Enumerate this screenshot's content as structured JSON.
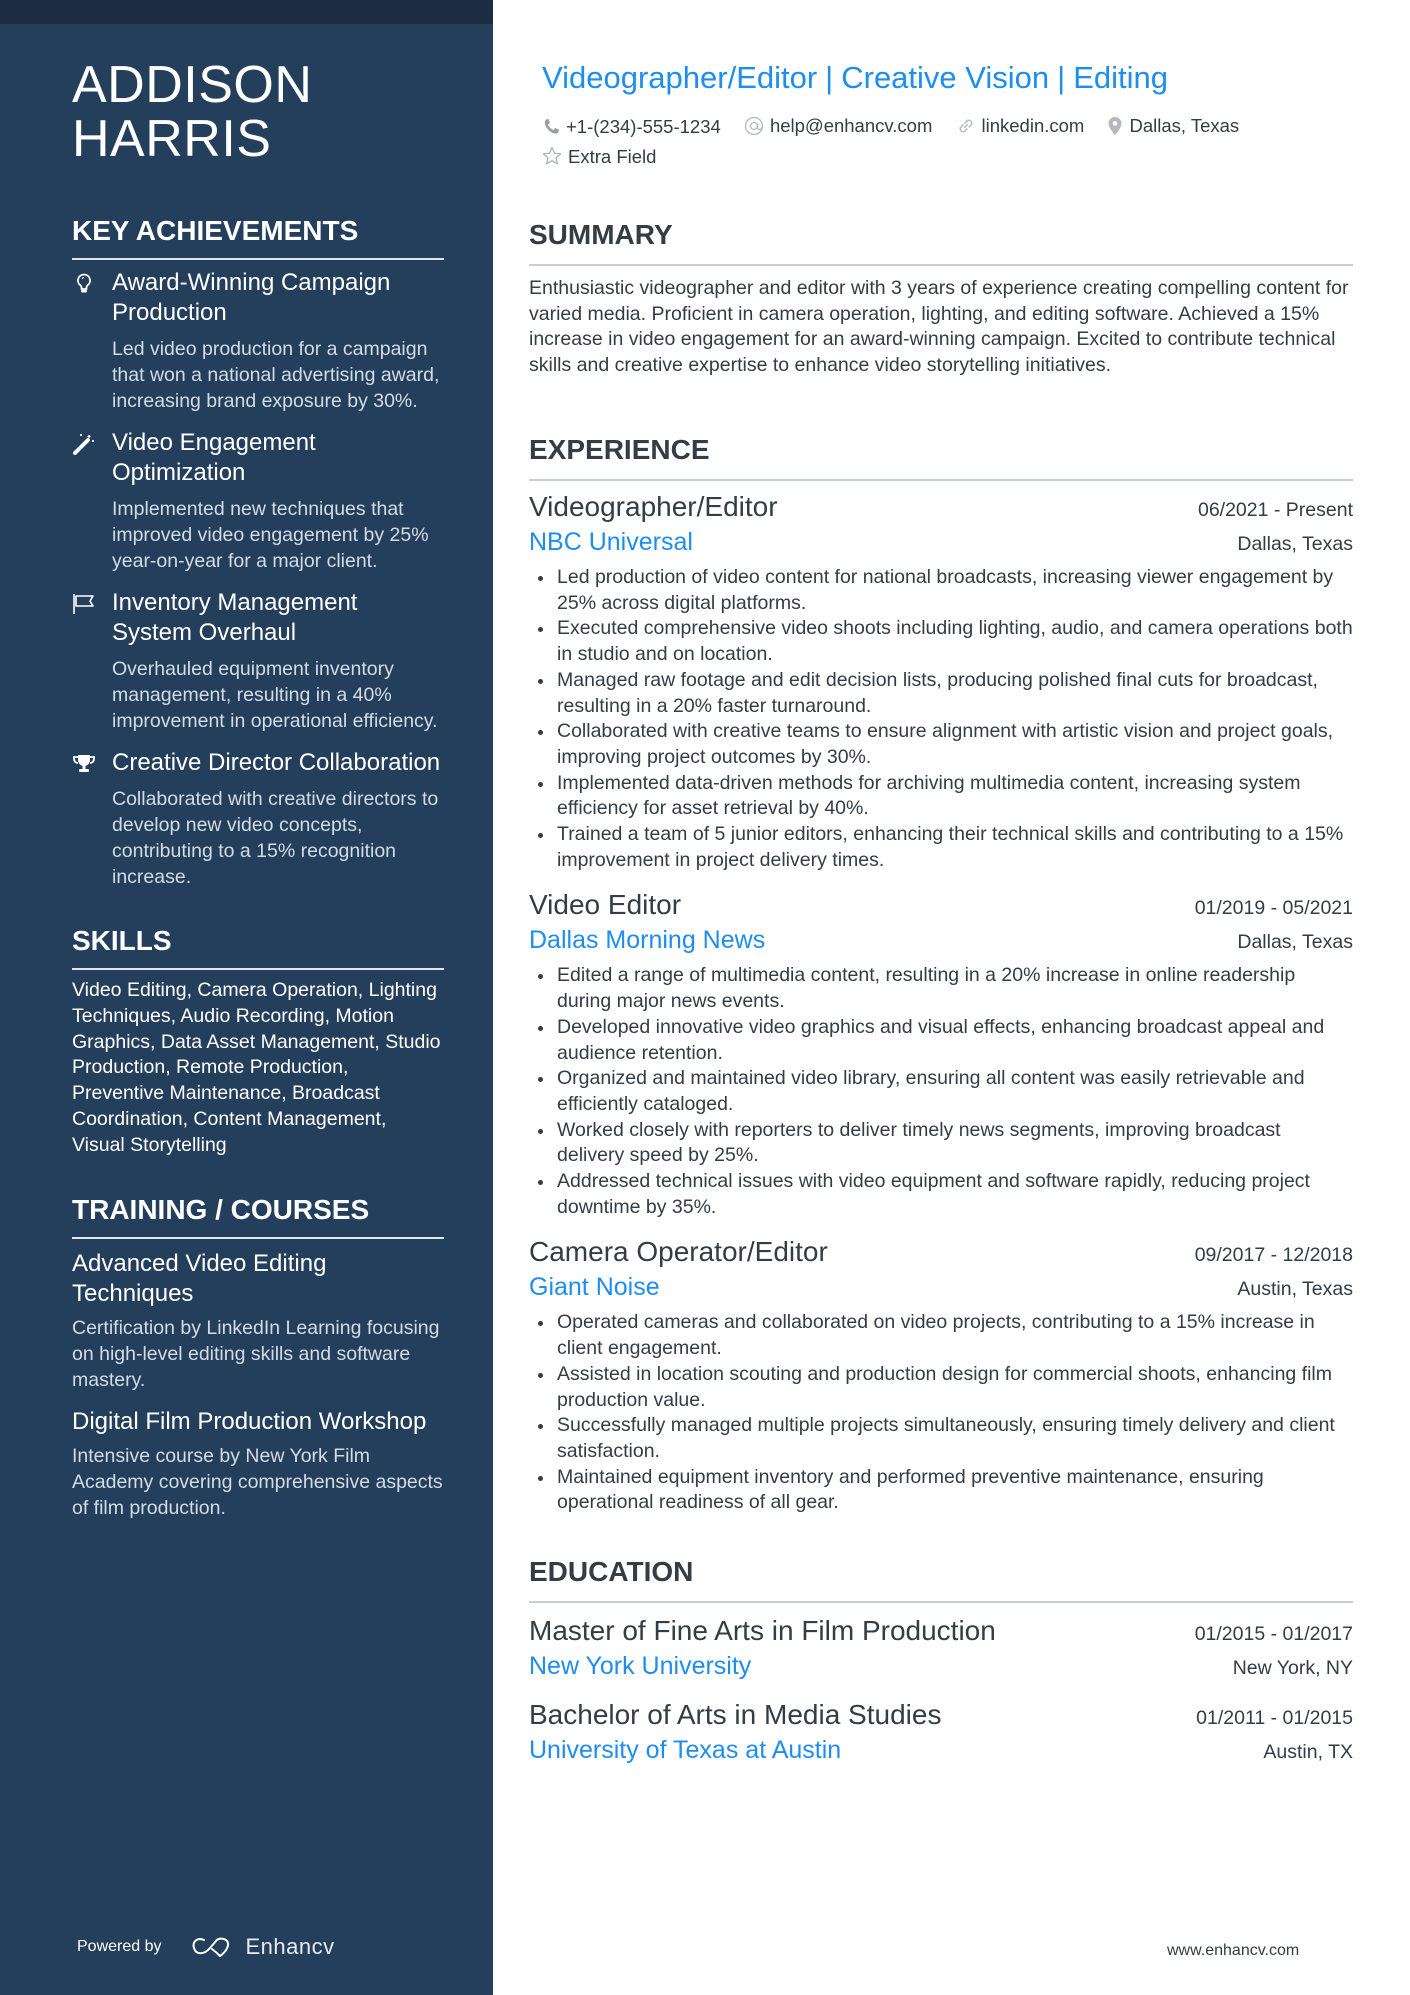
{
  "profile": {
    "name_line1": "ADDISON",
    "name_line2": "HARRIS",
    "headline": [
      "Videographer/Editor",
      "Creative Vision",
      "Editing"
    ],
    "headline_separator": "|",
    "contacts": {
      "phone": "+1-(234)-555-1234",
      "email": "help@enhancv.com",
      "link": "linkedin.com",
      "location": "Dallas, Texas",
      "extra": "Extra Field"
    }
  },
  "sidebar": {
    "achievements_heading": "KEY ACHIEVEMENTS",
    "achievements": [
      {
        "icon": "lightbulb-icon",
        "title": "Award-Winning Campaign Production",
        "desc": "Led video production for a campaign that won a national advertising award, increasing brand exposure by 30%."
      },
      {
        "icon": "magic-wand-icon",
        "title": "Video Engagement Optimization",
        "desc": "Implemented new techniques that improved video engagement by 25% year-on-year for a major client."
      },
      {
        "icon": "flag-icon",
        "title": "Inventory Management System Overhaul",
        "desc": "Overhauled equipment inventory management, resulting in a 40% improvement in operational efficiency."
      },
      {
        "icon": "trophy-icon",
        "title": "Creative Director Collaboration",
        "desc": "Collaborated with creative directors to develop new video concepts, contributing to a 15% recognition increase."
      }
    ],
    "skills_heading": "SKILLS",
    "skills_text": "Video Editing, Camera Operation, Lighting Techniques, Audio Recording, Motion Graphics, Data Asset Management, Studio Production, Remote Production, Preventive Maintenance, Broadcast Coordination, Content Management, Visual Storytelling",
    "training_heading": "TRAINING / COURSES",
    "courses": [
      {
        "title": "Advanced Video Editing Techniques",
        "desc": "Certification by LinkedIn Learning focusing on high-level editing skills and software mastery."
      },
      {
        "title": "Digital Film Production Workshop",
        "desc": "Intensive course by New York Film Academy covering comprehensive aspects of film production."
      }
    ],
    "powered_by": "Powered by",
    "brand": "Enhancv"
  },
  "summary": {
    "heading": "SUMMARY",
    "text": "Enthusiastic videographer and editor with 3 years of experience creating compelling content for varied media. Proficient in camera operation, lighting, and editing software. Achieved a 15% increase in video engagement for an award-winning campaign. Excited to contribute technical skills and creative expertise to enhance video storytelling initiatives."
  },
  "experience": {
    "heading": "EXPERIENCE",
    "jobs": [
      {
        "title": "Videographer/Editor",
        "dates": "06/2021 - Present",
        "company": "NBC Universal",
        "location": "Dallas, Texas",
        "bullets": [
          "Led production of video content for national broadcasts, increasing viewer engagement by 25% across digital platforms.",
          "Executed comprehensive video shoots including lighting, audio, and camera operations both in studio and on location.",
          "Managed raw footage and edit decision lists, producing polished final cuts for broadcast, resulting in a 20% faster turnaround.",
          "Collaborated with creative teams to ensure alignment with artistic vision and project goals, improving project outcomes by 30%.",
          "Implemented data-driven methods for archiving multimedia content, increasing system efficiency for asset retrieval by 40%.",
          "Trained a team of 5 junior editors, enhancing their technical skills and contributing to a 15% improvement in project delivery times."
        ]
      },
      {
        "title": "Video Editor",
        "dates": "01/2019 - 05/2021",
        "company": "Dallas Morning News",
        "location": "Dallas, Texas",
        "bullets": [
          "Edited a range of multimedia content, resulting in a 20% increase in online readership during major news events.",
          "Developed innovative video graphics and visual effects, enhancing broadcast appeal and audience retention.",
          "Organized and maintained video library, ensuring all content was easily retrievable and efficiently cataloged.",
          "Worked closely with reporters to deliver timely news segments, improving broadcast delivery speed by 25%.",
          "Addressed technical issues with video equipment and software rapidly, reducing project downtime by 35%."
        ]
      },
      {
        "title": "Camera Operator/Editor",
        "dates": "09/2017 - 12/2018",
        "company": "Giant Noise",
        "location": "Austin, Texas",
        "bullets": [
          "Operated cameras and collaborated on video projects, contributing to a 15% increase in client engagement.",
          "Assisted in location scouting and production design for commercial shoots, enhancing film production value.",
          "Successfully managed multiple projects simultaneously, ensuring timely delivery and client satisfaction.",
          "Maintained equipment inventory and performed preventive maintenance, ensuring operational readiness of all gear."
        ]
      }
    ]
  },
  "education": {
    "heading": "EDUCATION",
    "items": [
      {
        "degree": "Master of Fine Arts in Film Production",
        "dates": "01/2015 - 01/2017",
        "school": "New York University",
        "location": "New York, NY"
      },
      {
        "degree": "Bachelor of Arts in Media Studies",
        "dates": "01/2011 - 01/2015",
        "school": "University of Texas at Austin",
        "location": "Austin, TX"
      }
    ]
  },
  "footer": {
    "url": "www.enhancv.com"
  },
  "colors": {
    "sidebar_bg": "#243f5c",
    "sidebar_strip": "#1c2d43",
    "accent": "#1e8df0",
    "text": "#343c45"
  }
}
